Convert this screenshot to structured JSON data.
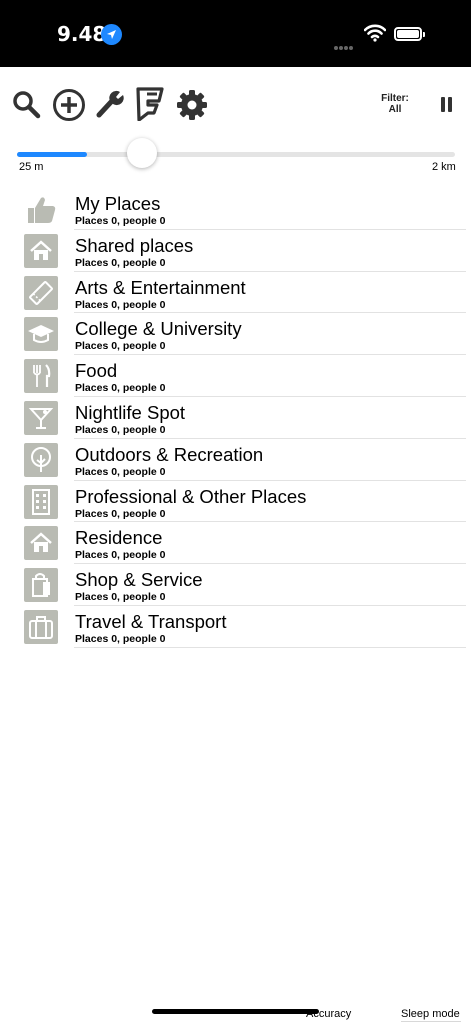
{
  "status_bar": {
    "time": "9.48",
    "icons": [
      "location-arrow-icon",
      "cellular-dots-icon",
      "wifi-icon",
      "battery-icon"
    ]
  },
  "toolbar": {
    "icons": [
      "search-icon",
      "add-circle-icon",
      "wrench-icon",
      "foursquare-icon",
      "gear-icon",
      "pause-icon"
    ],
    "filter_label": "Filter:",
    "filter_value": "All"
  },
  "slider": {
    "min_label": "25 m",
    "max_label": "2 km",
    "value_fraction": 0.16,
    "accent": "#1e88ff"
  },
  "categories": [
    {
      "title": "My Places",
      "subtitle": "Places 0, people 0",
      "icon": "thumbs-up-icon"
    },
    {
      "title": "Shared places",
      "subtitle": "Places 0, people 0",
      "icon": "home-icon"
    },
    {
      "title": "Arts & Entertainment",
      "subtitle": "Places 0, people 0",
      "icon": "ticket-icon"
    },
    {
      "title": "College & University",
      "subtitle": "Places 0, people 0",
      "icon": "graduation-cap-icon"
    },
    {
      "title": "Food",
      "subtitle": "Places 0, people 0",
      "icon": "fork-knife-icon"
    },
    {
      "title": "Nightlife Spot",
      "subtitle": "Places 0, people 0",
      "icon": "cocktail-icon"
    },
    {
      "title": "Outdoors & Recreation",
      "subtitle": "Places 0, people 0",
      "icon": "tree-icon"
    },
    {
      "title": "Professional & Other Places",
      "subtitle": "Places 0, people 0",
      "icon": "building-icon"
    },
    {
      "title": "Residence",
      "subtitle": "Places 0, people 0",
      "icon": "home-icon"
    },
    {
      "title": "Shop & Service",
      "subtitle": "Places 0, people 0",
      "icon": "shopping-bag-icon"
    },
    {
      "title": "Travel & Transport",
      "subtitle": "Places 0, people 0",
      "icon": "suitcase-icon"
    }
  ],
  "bottom_bar": {
    "accuracy_label": "Accuracy",
    "sleep_label": "Sleep mode"
  },
  "colors": {
    "icon_tile": "#b9bbb3",
    "status_bar": "#000000",
    "location_badge": "#1e88ff"
  }
}
